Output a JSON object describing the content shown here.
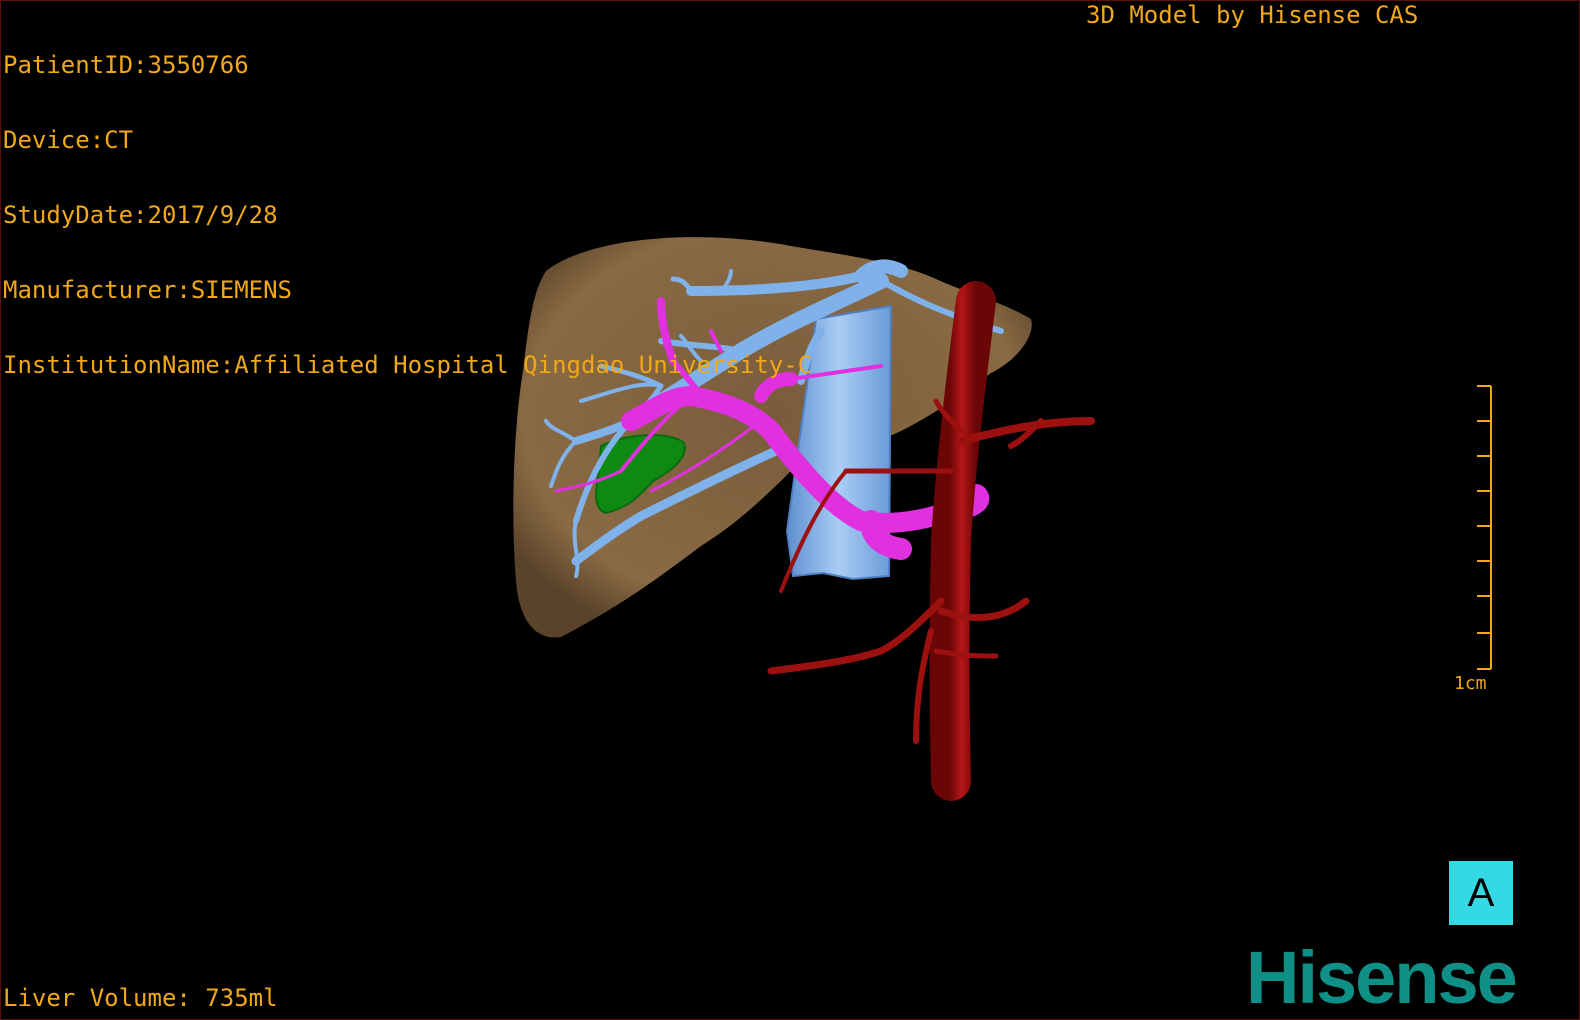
{
  "patient_info": {
    "patient_id": "PatientID:3550766",
    "device": "Device:CT",
    "study_date": "StudyDate:2017/9/28",
    "manufacturer": "Manufacturer:SIEMENS",
    "institution": "InstitutionName:Affiliated Hospital Qingdao University-C"
  },
  "credit": "3D Model by Hisense CAS",
  "liver_volume": "Liver Volume: 735ml",
  "scale_bar": {
    "label": "1cm"
  },
  "orientation": {
    "label": "A"
  },
  "logo": "Hisense",
  "colors": {
    "text": "#f0a818",
    "liver": "#8a6a44",
    "hepatic_vein": "#7fb2ea",
    "portal_vein": "#e030e0",
    "artery": "#a01010",
    "gallbladder": "#0e8a12",
    "orientation_bg": "#35d9e3",
    "logo": "#0f8f86"
  }
}
